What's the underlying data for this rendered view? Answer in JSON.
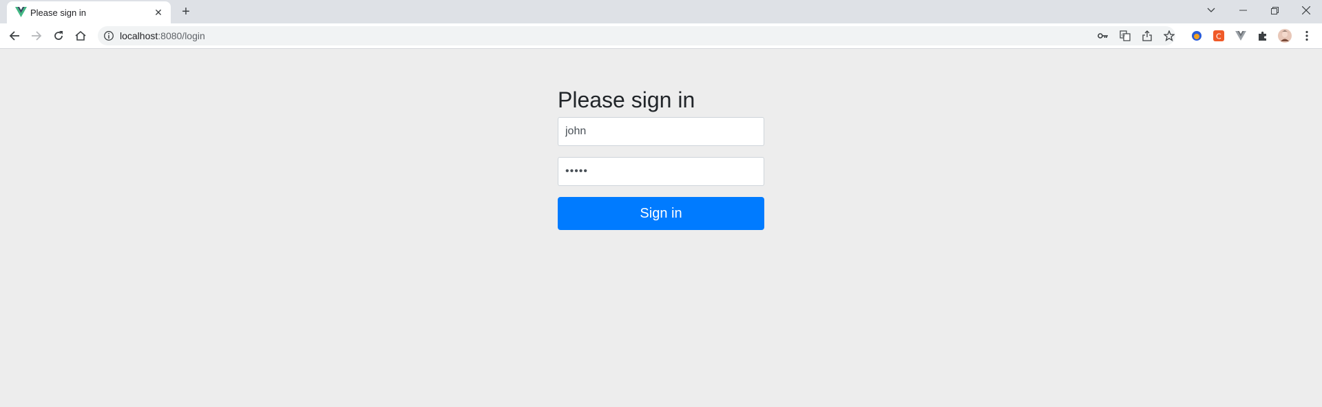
{
  "browser": {
    "tab": {
      "title": "Please sign in",
      "favicon": "vue-logo-icon"
    },
    "address": {
      "host": "localhost",
      "rest": ":8080/login"
    }
  },
  "form": {
    "heading": "Please sign in",
    "username_value": "john",
    "password_value": "•••••",
    "submit_label": "Sign in"
  },
  "colors": {
    "page_background": "#ededed",
    "tabstrip_background": "#dee1e6",
    "primary_button": "#007bff",
    "heading_text": "#212529"
  }
}
